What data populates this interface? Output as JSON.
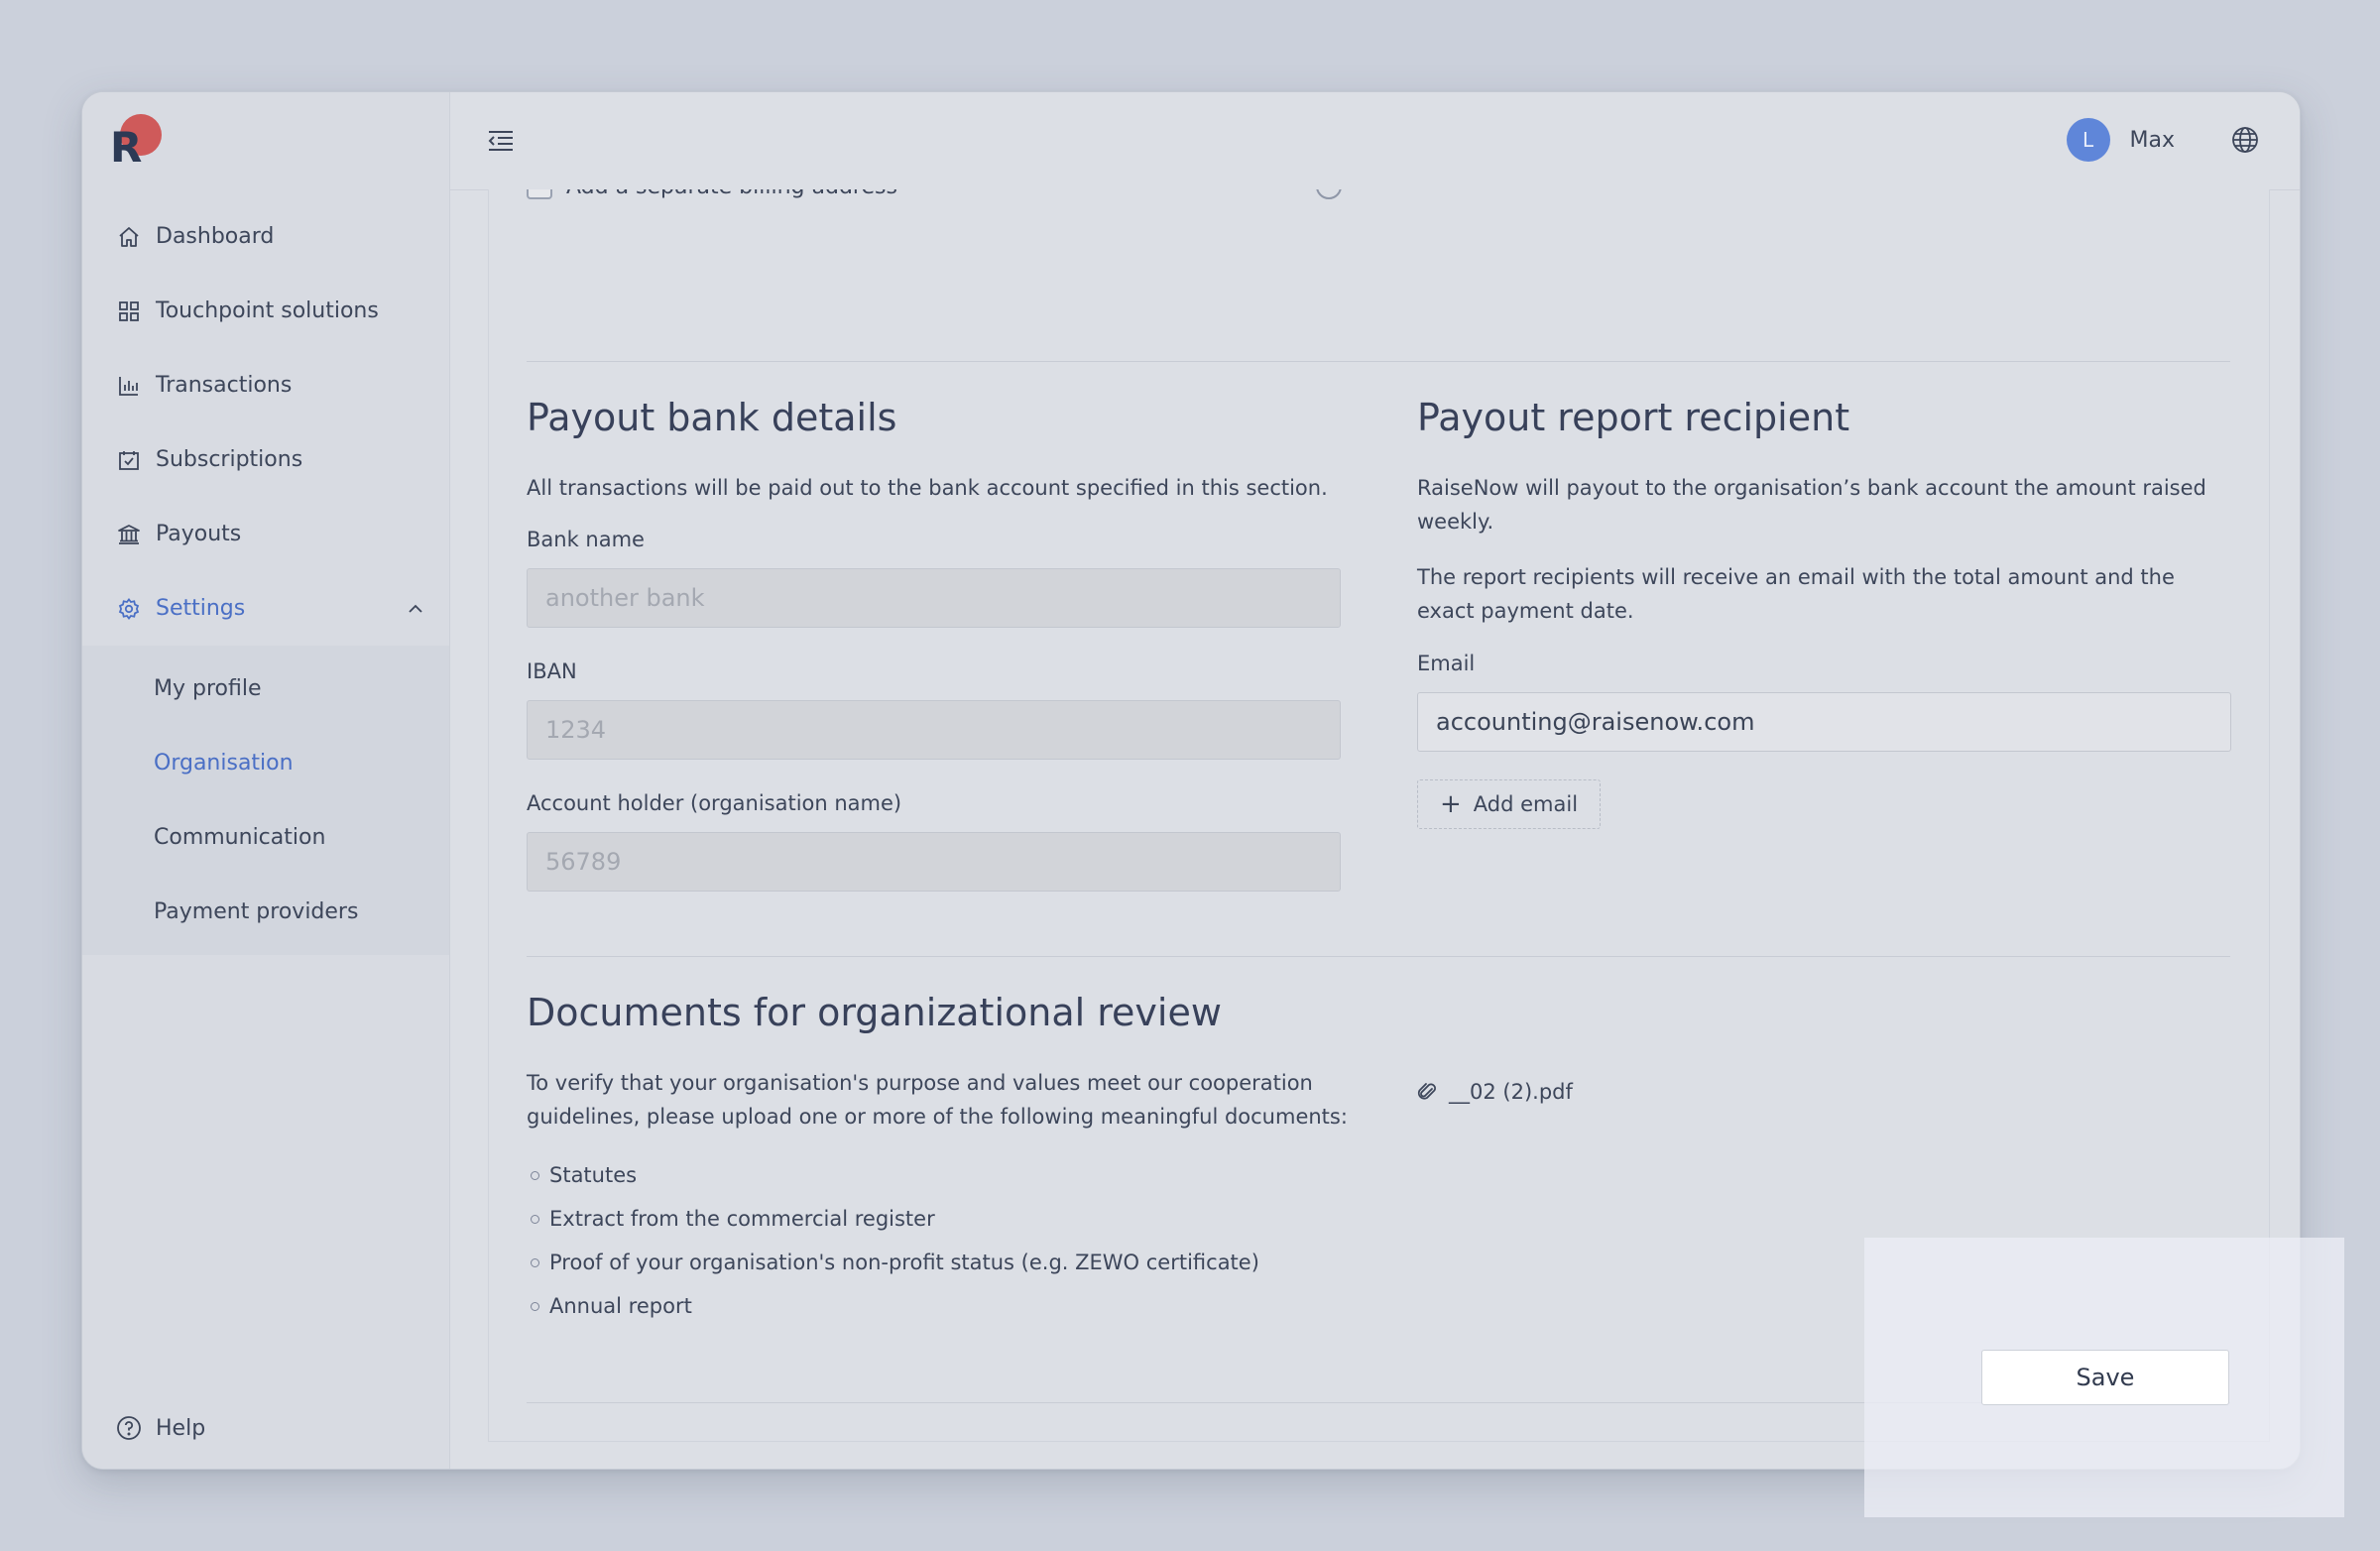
{
  "app": {
    "logo_letter": "R",
    "brand_color": "#cf5a5a",
    "accent_color": "#4a6fc5"
  },
  "sidebar": {
    "items": [
      {
        "label": "Dashboard",
        "icon": "home-icon"
      },
      {
        "label": "Touchpoint solutions",
        "icon": "grid-icon"
      },
      {
        "label": "Transactions",
        "icon": "bar-chart-icon"
      },
      {
        "label": "Subscriptions",
        "icon": "calendar-check-icon"
      },
      {
        "label": "Payouts",
        "icon": "bank-icon"
      },
      {
        "label": "Settings",
        "icon": "gear-icon",
        "expanded": true
      }
    ],
    "settings_sub": [
      {
        "label": "My profile"
      },
      {
        "label": "Organisation",
        "active": true
      },
      {
        "label": "Communication"
      },
      {
        "label": "Payment providers"
      }
    ],
    "help_label": "Help"
  },
  "header": {
    "avatar_initial": "L",
    "user_name": "Max"
  },
  "clipped_row": {
    "label": "Add a separate billing address"
  },
  "payout_bank": {
    "title": "Payout bank details",
    "description": "All transactions will be paid out to the bank account specified in this section.",
    "bank_name_label": "Bank name",
    "bank_name_value": "another bank",
    "iban_label": "IBAN",
    "iban_value": "1234",
    "holder_label": "Account holder (organisation name)",
    "holder_value": "56789"
  },
  "payout_report": {
    "title": "Payout report recipient",
    "description1": "RaiseNow will payout to the organisation’s bank account the amount raised weekly.",
    "description2": "The report recipients will receive an email with the total amount and the exact payment date.",
    "email_label": "Email",
    "email_value": "accounting@raisenow.com",
    "add_email_label": "Add email"
  },
  "documents": {
    "title": "Documents for organizational review",
    "description": "To verify that your organisation's purpose and values meet our cooperation guidelines, please upload one or more of the following meaningful documents:",
    "items": [
      "Statutes",
      "Extract from the commercial register",
      "Proof of your organisation's non-profit status (e.g. ZEWO certificate)",
      "Annual report"
    ],
    "file_name": "__02 (2).pdf"
  },
  "actions": {
    "save_label": "Save"
  }
}
